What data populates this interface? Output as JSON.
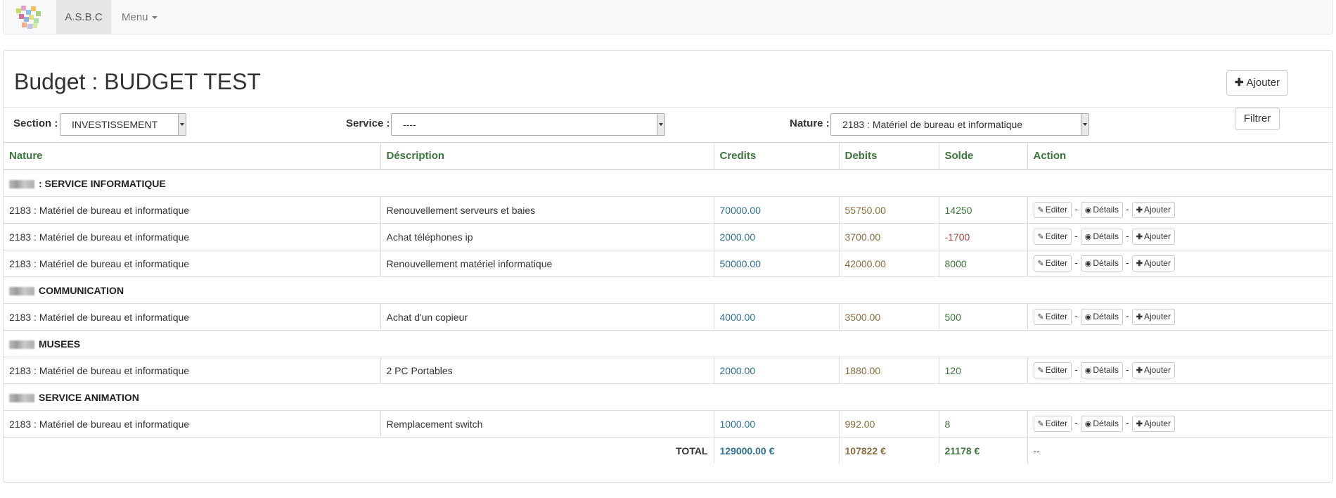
{
  "navbar": {
    "brand": "A.S.B.C",
    "menu": "Menu"
  },
  "page": {
    "title": "Budget : BUDGET TEST",
    "add_button": "Ajouter"
  },
  "filters": {
    "section_label": "Section :",
    "section_value": "INVESTISSEMENT",
    "service_label": "Service :",
    "service_value": "----",
    "nature_label": "Nature :",
    "nature_value": "2183 : Matériel de bureau et informatique",
    "filter_button": "Filtrer"
  },
  "table": {
    "headers": [
      "Nature",
      "Déscription",
      "Credits",
      "Debits",
      "Solde",
      "Action"
    ],
    "action_labels": {
      "edit": "Editer",
      "details": "Détails",
      "add": "Ajouter",
      "sep": "-"
    },
    "groups": [
      {
        "name": ": SERVICE INFORMATIQUE",
        "rows": [
          {
            "nature": "2183 : Matériel de bureau et informatique",
            "description": "Renouvellement serveurs et baies",
            "credits": "70000.00",
            "debits": "55750.00",
            "solde": "14250"
          },
          {
            "nature": "2183 : Matériel de bureau et informatique",
            "description": "Achat téléphones ip",
            "credits": "2000.00",
            "debits": "3700.00",
            "solde": "-1700"
          },
          {
            "nature": "2183 : Matériel de bureau et informatique",
            "description": "Renouvellement matériel informatique",
            "credits": "50000.00",
            "debits": "42000.00",
            "solde": "8000"
          }
        ]
      },
      {
        "name": "COMMUNICATION",
        "rows": [
          {
            "nature": "2183 : Matériel de bureau et informatique",
            "description": "Achat d'un copieur",
            "credits": "4000.00",
            "debits": "3500.00",
            "solde": "500"
          }
        ]
      },
      {
        "name": "MUSEES",
        "rows": [
          {
            "nature": "2183 : Matériel de bureau et informatique",
            "description": "2 PC Portables",
            "credits": "2000.00",
            "debits": "1880.00",
            "solde": "120"
          }
        ]
      },
      {
        "name": "SERVICE ANIMATION",
        "rows": [
          {
            "nature": "2183 : Matériel de bureau et informatique",
            "description": "Remplacement switch",
            "credits": "1000.00",
            "debits": "992.00",
            "solde": "8"
          }
        ]
      }
    ],
    "total": {
      "label": "TOTAL",
      "credits": "129000.00 €",
      "debits": "107822 €",
      "solde": "21178 €",
      "action": "--"
    }
  },
  "colors": {
    "header_green": "#3c763d",
    "credit_blue": "#31708f",
    "debit_brown": "#8a6d3b",
    "solde_negative": "#a94442"
  }
}
